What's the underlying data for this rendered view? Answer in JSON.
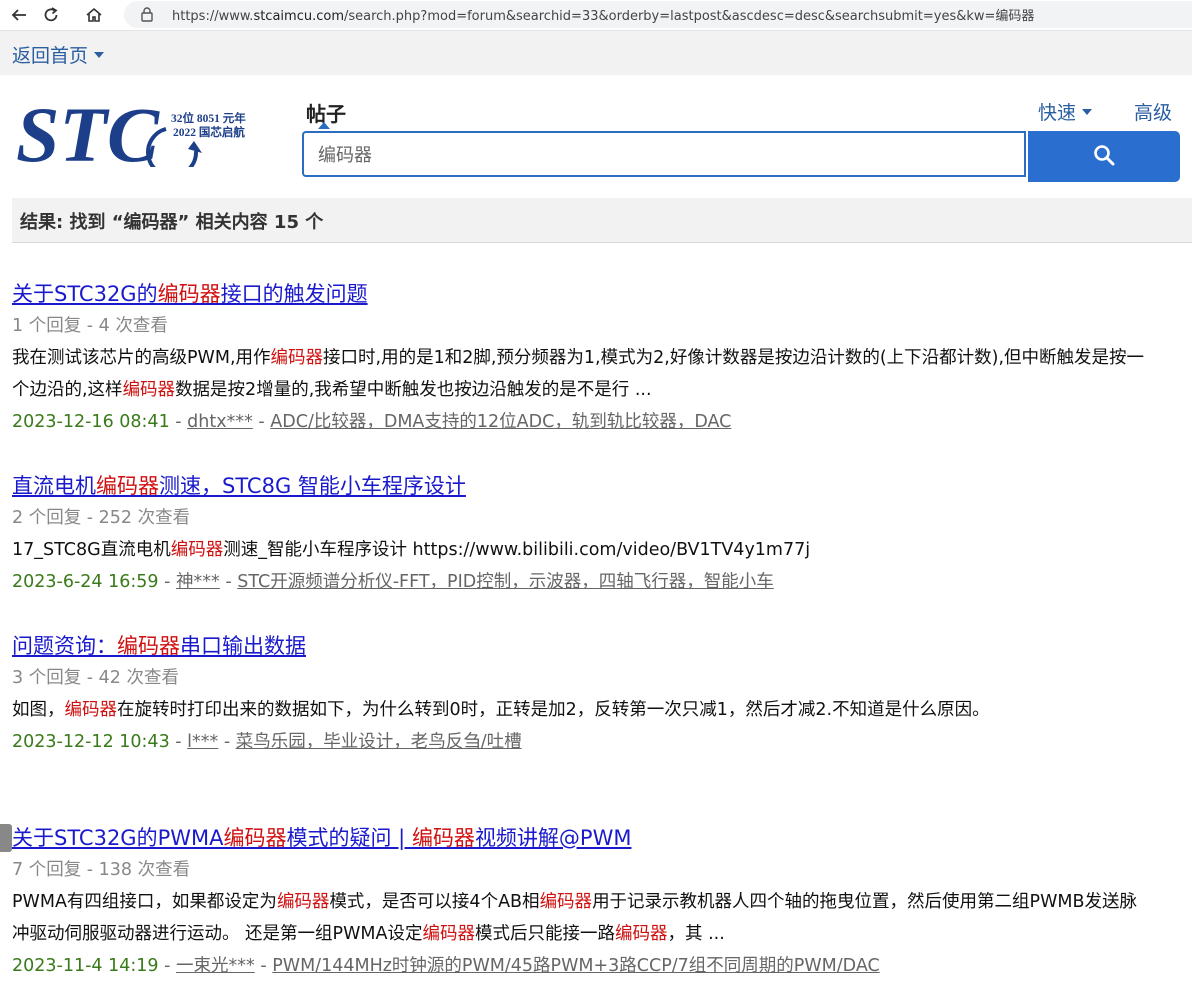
{
  "browser": {
    "url_prefix": "https://www.",
    "url_host": "stcaimcu.com",
    "url_rest": "/search.php?mod=forum&searchid=33&orderby=lastpost&ascdesc=desc&searchsubmit=yes&kw=编码器"
  },
  "topnav": {
    "back_home": "返回首页"
  },
  "logo": {
    "brand": "STC",
    "line1": "32位 8051 元年",
    "line2": "2022 国芯启航"
  },
  "search": {
    "type_label": "帖子",
    "quick_label": "快速",
    "advanced_label": "高级",
    "query": "编码器"
  },
  "result_summary": "结果: 找到 “编码器” 相关内容 15 个",
  "results": [
    {
      "title": [
        {
          "t": "关于STC32G的"
        },
        {
          "t": "编码器",
          "hl": true
        },
        {
          "t": "接口的触发问题"
        }
      ],
      "stats": "1 个回复 - 4 次查看",
      "body": [
        {
          "t": "我在测试该芯片的高级PWM,用作"
        },
        {
          "t": "编码器",
          "hl": true
        },
        {
          "t": "接口时,用的是1和2脚,预分频器为1,模式为2,好像计数器是按边沿计数的(上下沿都计数),但中断触发是按一个边沿的,这样"
        },
        {
          "t": "编码器",
          "hl": true
        },
        {
          "t": "数据是按2增量的,我希望中断触发也按边沿触发的是不是行 ..."
        }
      ],
      "date": "2023-12-16 08:41",
      "author": "dhtx***",
      "forum": "ADC/比较器，DMA支持的12位ADC，轨到轨比较器，DAC"
    },
    {
      "title": [
        {
          "t": "直流电机"
        },
        {
          "t": "编码器",
          "hl": true
        },
        {
          "t": "测速，STC8G  智能小车程序设计"
        }
      ],
      "stats": "2 个回复 - 252 次查看",
      "body": [
        {
          "t": "17_STC8G直流电机"
        },
        {
          "t": "编码器",
          "hl": true
        },
        {
          "t": "测速_智能小车程序设计 https://www.bilibili.com/video/BV1TV4y1m77j"
        }
      ],
      "date": "2023-6-24 16:59",
      "author": "神***",
      "forum": "STC开源频谱分析仪-FFT，PID控制，示波器，四轴飞行器，智能小车"
    },
    {
      "title": [
        {
          "t": "问题资询："
        },
        {
          "t": "编码器",
          "hl": true
        },
        {
          "t": "串口输出数据"
        }
      ],
      "stats": "3 个回复 - 42 次查看",
      "body": [
        {
          "t": "如图，"
        },
        {
          "t": "编码器",
          "hl": true
        },
        {
          "t": "在旋转时打印出来的数据如下，为什么转到0时，正转是加2，反转第一次只减1，然后才减2.不知道是什么原因。"
        }
      ],
      "date": "2023-12-12 10:43",
      "author": "l***",
      "forum": "菜鸟乐园，毕业设计，老鸟反刍/吐槽"
    },
    {
      "title": [
        {
          "t": "关于STC32G的PWMA"
        },
        {
          "t": "编码器",
          "hl": true
        },
        {
          "t": "模式的疑问 | "
        },
        {
          "t": "编码器",
          "hl": true
        },
        {
          "t": "视频讲解@PWM"
        }
      ],
      "stats": "7 个回复 - 138 次查看",
      "body": [
        {
          "t": "PWMA有四组接口，如果都设定为"
        },
        {
          "t": "编码器",
          "hl": true
        },
        {
          "t": "模式，是否可以接4个AB相"
        },
        {
          "t": "编码器",
          "hl": true
        },
        {
          "t": "用于记录示教机器人四个轴的拖曳位置，然后使用第二组PWMB发送脉冲驱动伺服驱动器进行运动。 还是第一组PWMA设定"
        },
        {
          "t": "编码器",
          "hl": true
        },
        {
          "t": "模式后只能接一路"
        },
        {
          "t": "编码器",
          "hl": true
        },
        {
          "t": "，其 ..."
        }
      ],
      "date": "2023-11-4 14:19",
      "author": "一束光***",
      "forum": "PWM/144MHz时钟源的PWM/45路PWM+3路CCP/7组不同周期的PWM/DAC"
    }
  ]
}
